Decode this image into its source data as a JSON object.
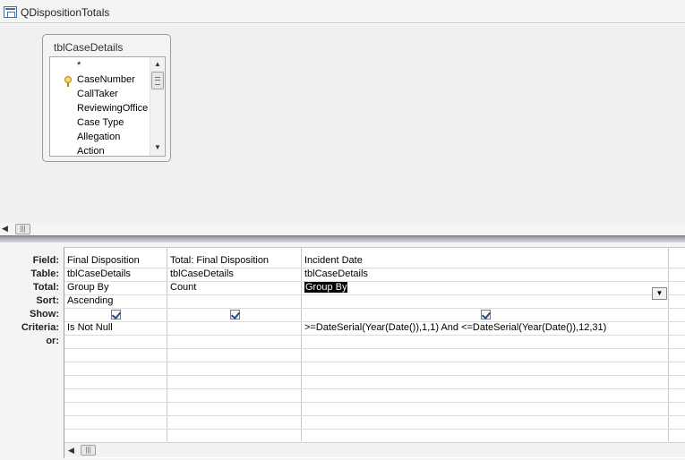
{
  "window": {
    "title": "QDispositionTotals"
  },
  "table": {
    "name": "tblCaseDetails",
    "fields": [
      "*",
      "CaseNumber",
      "CallTaker",
      "ReviewingOffice",
      "Case Type",
      "Allegation",
      "Action"
    ]
  },
  "grid": {
    "row_labels": [
      "Field:",
      "Table:",
      "Total:",
      "Sort:",
      "Show:",
      "Criteria:",
      "or:"
    ],
    "columns": [
      {
        "field": "Final Disposition",
        "table": "tblCaseDetails",
        "total": "Group By",
        "sort": "Ascending",
        "show": true,
        "criteria": "Is Not Null",
        "or": ""
      },
      {
        "field": "Total: Final Disposition",
        "table": "tblCaseDetails",
        "total": "Count",
        "sort": "",
        "show": true,
        "criteria": "",
        "or": ""
      },
      {
        "field": "Incident Date",
        "table": "tblCaseDetails",
        "total": "Group By",
        "sort": "",
        "show": true,
        "criteria": ">=DateSerial(Year(Date()),1,1) And <=DateSerial(Year(Date()),12,31)",
        "or": ""
      }
    ]
  },
  "icons": {
    "query": "query-icon",
    "key": "primary-key-icon",
    "dropdown": "chevron-down-icon"
  }
}
